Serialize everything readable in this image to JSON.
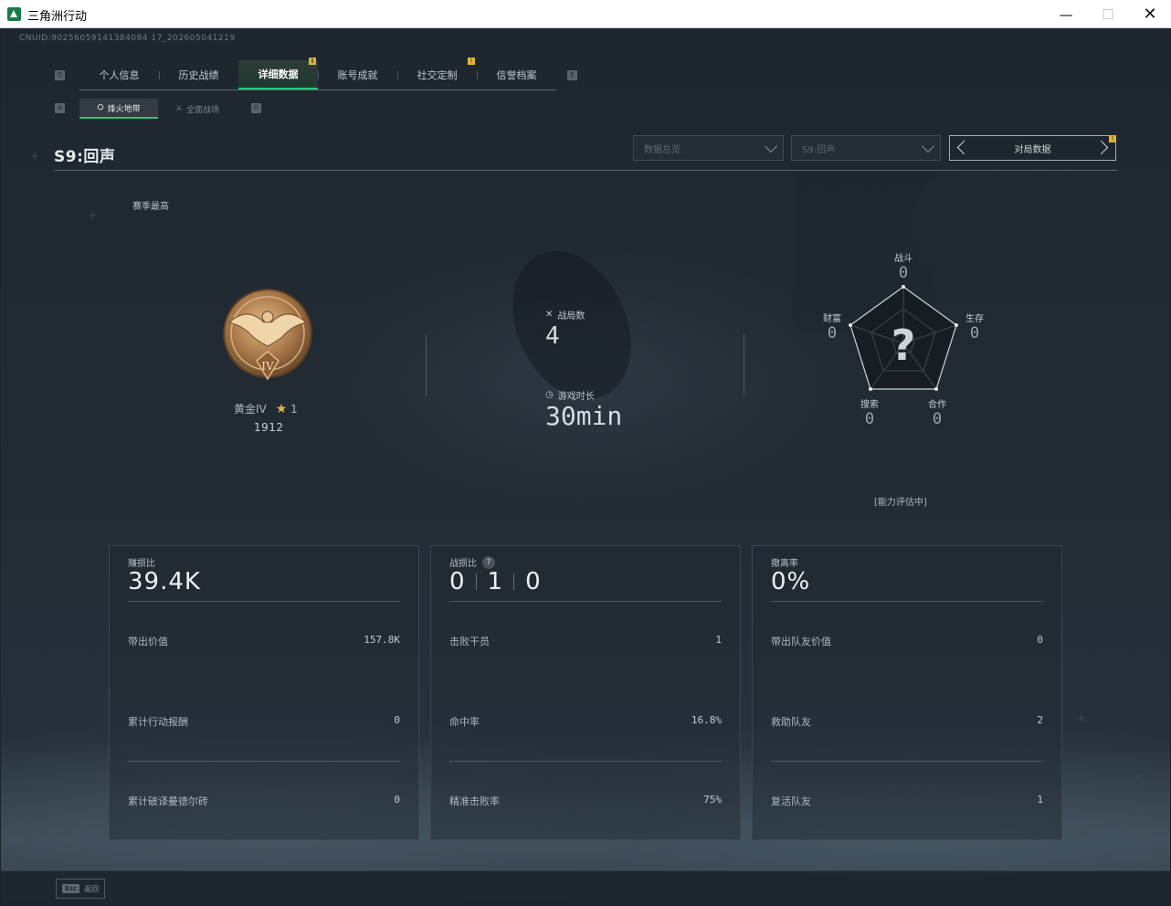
{
  "window": {
    "title": "三角洲行动",
    "minimize": "—",
    "maximize": "☐",
    "close": "✕"
  },
  "header": {
    "uid": "CNUID:90256059141384084 17_202605041219"
  },
  "tabs": {
    "left_key": "Q",
    "right_key": "E",
    "items": [
      {
        "label": "个人信息"
      },
      {
        "label": "历史战绩"
      },
      {
        "label": "详细数据",
        "notice": "!"
      },
      {
        "label": "账号成就"
      },
      {
        "label": "社交定制",
        "notice": "!"
      },
      {
        "label": "信誉档案"
      }
    ]
  },
  "subtabs": {
    "left_key": "A",
    "right_key": "D",
    "items": [
      {
        "label": "烽火地带",
        "icon": "beacon-icon"
      },
      {
        "label": "全面战场",
        "icon": "battlefield-icon"
      }
    ]
  },
  "season": {
    "title": "S9:回声",
    "best_label": "赛季最高"
  },
  "filters": {
    "dropdown_1": "数据总览",
    "dropdown_2": "S9:回声",
    "pager_label": "对局数据",
    "pager_notice": "!"
  },
  "rank": {
    "tier": "黄金IV",
    "medal_numeral": "IV",
    "stars": "1",
    "score": "1912"
  },
  "stats": {
    "matches_label": "战局数",
    "matches_value": "4",
    "playtime_label": "游戏时长",
    "playtime_value": "30min"
  },
  "radar": {
    "center_symbol": "?",
    "axes": [
      {
        "label": "战斗",
        "value": "0"
      },
      {
        "label": "生存",
        "value": "0"
      },
      {
        "label": "合作",
        "value": "0"
      },
      {
        "label": "搜索",
        "value": "0"
      },
      {
        "label": "财富",
        "value": "0"
      }
    ],
    "status": "[能力评估中]"
  },
  "cards": [
    {
      "head_label": "赚损比",
      "head_value": "39.4K",
      "rows": [
        {
          "label": "带出价值",
          "value": "157.8K"
        },
        {
          "label": "累计行动报酬",
          "value": "0"
        },
        {
          "label": "累计破译曼德尔砖",
          "value": "0"
        }
      ]
    },
    {
      "head_label": "战损比",
      "help": "?",
      "kd": [
        "0",
        "1",
        "0"
      ],
      "rows": [
        {
          "label": "击败干员",
          "value": "1"
        },
        {
          "label": "命中率",
          "value": "16.8%"
        },
        {
          "label": "精准击败率",
          "value": "75%"
        }
      ]
    },
    {
      "head_label": "撤离率",
      "head_value": "0%",
      "rows": [
        {
          "label": "带出队友价值",
          "value": "0"
        },
        {
          "label": "救助队友",
          "value": "2"
        },
        {
          "label": "复活队友",
          "value": "1"
        }
      ]
    }
  ],
  "footer": {
    "esc_key": "Esc",
    "esc_label": "返回"
  },
  "colors": {
    "accent_green": "#25c779",
    "notice_gold": "#e3b337",
    "medal_bronze": "#b98a55"
  }
}
